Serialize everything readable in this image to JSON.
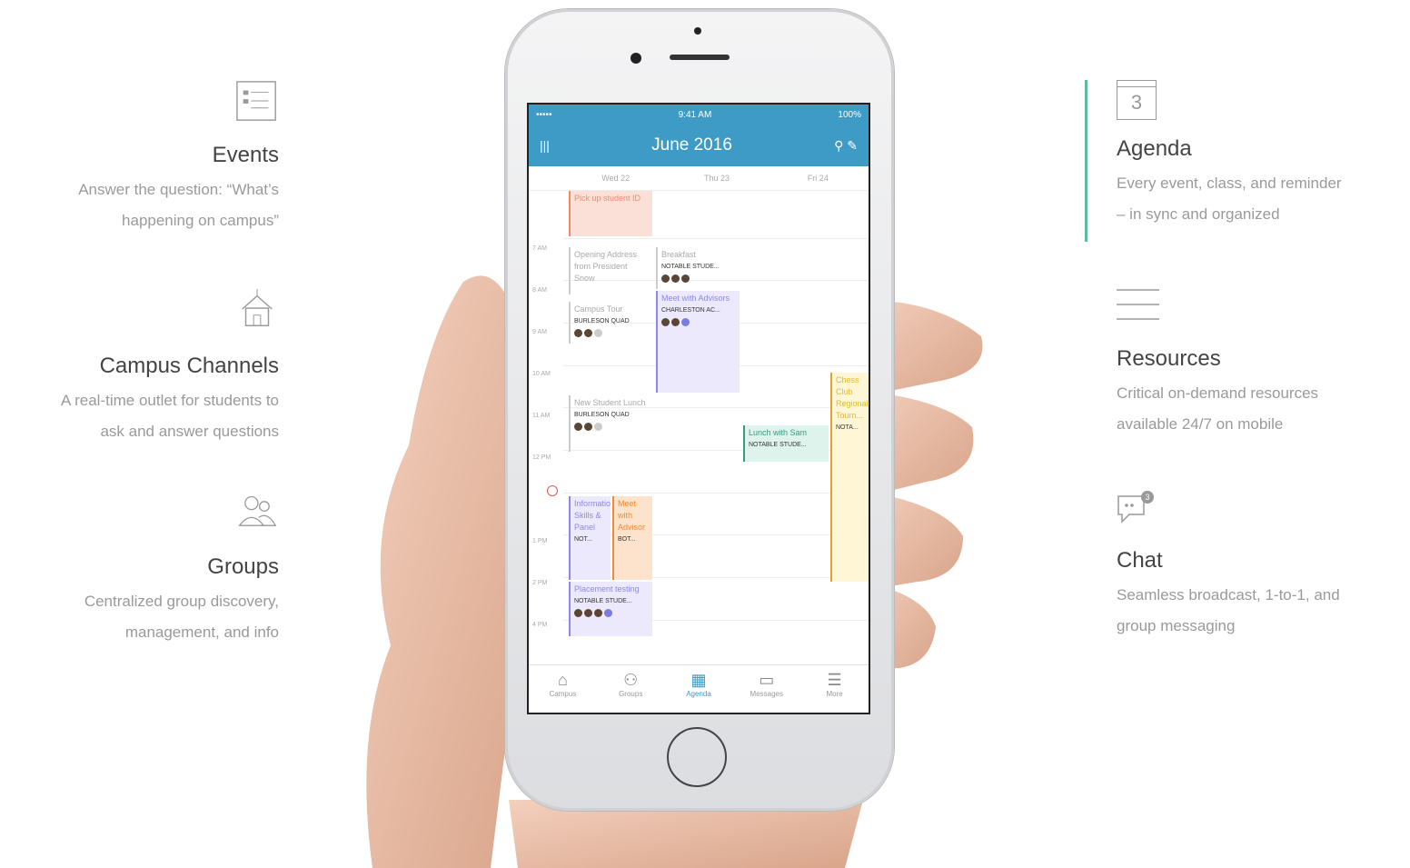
{
  "features_left": [
    {
      "icon": "list-document-icon",
      "title": "Events",
      "desc_lines": [
        "Answer the question: “What’s",
        "happening on campus”"
      ]
    },
    {
      "icon": "campus-building-icon",
      "title": "Campus Channels",
      "desc_lines": [
        "A real-time outlet for students to",
        "ask and answer questions"
      ]
    },
    {
      "icon": "people-group-icon",
      "title": "Groups",
      "desc_lines": [
        "Centralized group discovery,",
        "management, and info"
      ]
    }
  ],
  "features_right": [
    {
      "icon": "calendar-3-icon",
      "icon_text": "3",
      "title": "Agenda",
      "desc_lines": [
        "Every event, class, and reminder",
        "– in sync and organized"
      ]
    },
    {
      "icon": "hamburger-lines-icon",
      "title": "Resources",
      "desc_lines": [
        "Critical on-demand resources",
        "available 24/7 on mobile"
      ]
    },
    {
      "icon": "chat-bubble-icon",
      "title": "Chat",
      "desc_lines": [
        "Seamless broadcast, 1-to-1, and",
        "group messaging"
      ]
    }
  ],
  "accent_color": "#5fb8a0",
  "phone": {
    "status": {
      "signal": "••••• ",
      "time": "9:41 AM",
      "battery": "100%"
    },
    "nav_title": "June 2016",
    "days": [
      "Wed 22",
      "Thu 23",
      "Fri 24"
    ],
    "times": [
      "7 AM",
      "8 AM",
      "9 AM",
      "10 AM",
      "11 AM",
      "12 PM",
      "1 PM",
      "2 PM",
      "4 PM"
    ],
    "events": [
      {
        "title": "Pick up student ID",
        "meta": ""
      },
      {
        "title": "Opening Address from President Snow",
        "meta": ""
      },
      {
        "title": "Breakfast",
        "meta": "NOTABLE STUDE..."
      },
      {
        "title": "Meet with Advisors",
        "meta": "CHARLESTON AC..."
      },
      {
        "title": "Campus Tour",
        "meta": "BURLESON QUAD"
      },
      {
        "title": "New Student Lunch",
        "meta": "BURLESON QUAD"
      },
      {
        "title": "Lunch with Sam",
        "meta": "NOTABLE STUDE..."
      },
      {
        "title": "Informational Skills & Panel",
        "meta": "NOT..."
      },
      {
        "title": "Meet with Advisor",
        "meta": "BOT..."
      },
      {
        "title": "Placement testing",
        "meta": "NOTABLE STUDE..."
      },
      {
        "title": "Chess Club Regional Tourn...",
        "meta": "NOTA..."
      }
    ],
    "tabs": [
      {
        "icon": "campus-tab-icon",
        "glyph": "⌂",
        "label": "Campus"
      },
      {
        "icon": "groups-tab-icon",
        "glyph": "⚇",
        "label": "Groups"
      },
      {
        "icon": "agenda-tab-icon",
        "glyph": "▦",
        "label": "Agenda"
      },
      {
        "icon": "messages-tab-icon",
        "glyph": "▭",
        "label": "Messages"
      },
      {
        "icon": "more-tab-icon",
        "glyph": "☰",
        "label": "More"
      }
    ]
  }
}
